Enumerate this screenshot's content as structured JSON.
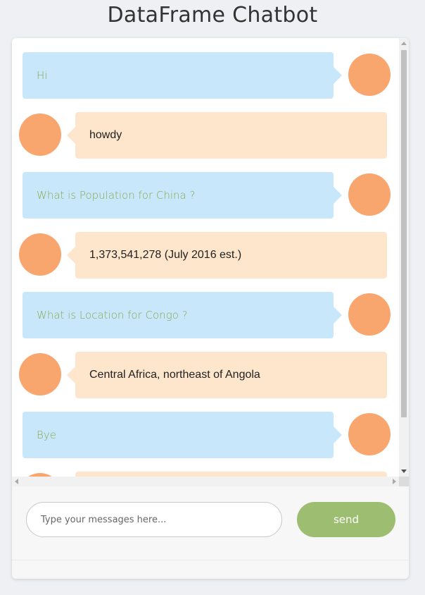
{
  "page": {
    "title": "DataFrame Chatbot"
  },
  "colors": {
    "user_bubble": "#c8e7fa",
    "bot_bubble": "#fde6cc",
    "user_text": "#8aa956",
    "avatar": "#f8a66e",
    "send_button": "#9dbd71"
  },
  "messages": [
    {
      "sender": "user",
      "text": "Hi"
    },
    {
      "sender": "bot",
      "text": "howdy"
    },
    {
      "sender": "user",
      "text": "What is Population for China ?"
    },
    {
      "sender": "bot",
      "text": "1,373,541,278 (July 2016 est.)"
    },
    {
      "sender": "user",
      "text": "What is Location for Congo ?"
    },
    {
      "sender": "bot",
      "text": "Central Africa, northeast of Angola"
    },
    {
      "sender": "user",
      "text": "Bye"
    },
    {
      "sender": "bot",
      "text": ""
    }
  ],
  "composer": {
    "placeholder": "Type your messages here...",
    "value": "",
    "send_label": "send"
  }
}
